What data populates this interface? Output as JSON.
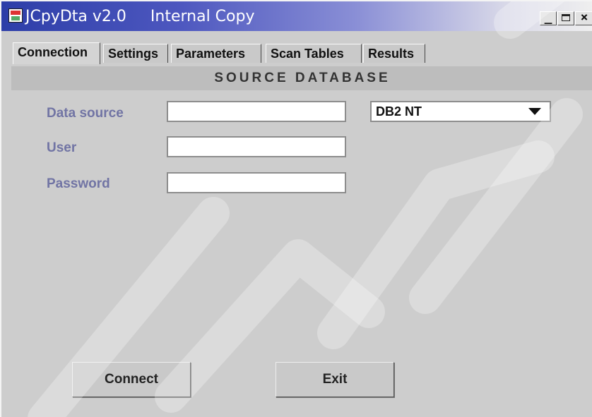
{
  "window": {
    "app_name": "JCpyDta v2.0",
    "subtitle": "Internal Copy",
    "controls": {
      "minimize": "_",
      "close": "×"
    }
  },
  "tabs": [
    {
      "label": "Connection",
      "active": true
    },
    {
      "label": "Settings",
      "active": false
    },
    {
      "label": "Parameters",
      "active": false
    },
    {
      "label": "Scan Tables",
      "active": false
    },
    {
      "label": "Results",
      "active": false
    }
  ],
  "section": {
    "title": "SOURCE DATABASE"
  },
  "form": {
    "data_source": {
      "label": "Data source",
      "value": ""
    },
    "user": {
      "label": "User",
      "value": ""
    },
    "password": {
      "label": "Password",
      "value": ""
    },
    "db_type": {
      "selected": "DB2 NT"
    }
  },
  "buttons": {
    "connect": "Connect",
    "exit": "Exit"
  },
  "colors": {
    "titlebar_start": "#2d3ea8",
    "label_text": "#7174a4",
    "panel_bg": "#cdcdcd",
    "header_bg": "#bdbdbd"
  },
  "icons": [
    "app-icon",
    "minimize-icon",
    "maximize-icon",
    "close-icon",
    "chevron-down-icon"
  ]
}
